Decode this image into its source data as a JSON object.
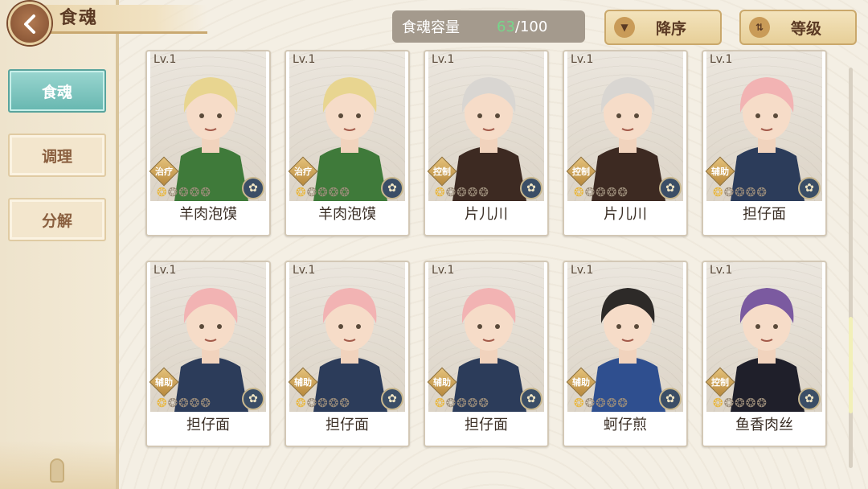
{
  "header": {
    "title": "食魂",
    "capacity_label": "食魂容量",
    "capacity_current": "63",
    "capacity_separator": "/",
    "capacity_max": "100",
    "sort_order_label": "降序",
    "sort_field_label": "等级"
  },
  "sidebar": {
    "tabs": [
      {
        "label": "食魂",
        "active": true
      },
      {
        "label": "调理",
        "active": false
      },
      {
        "label": "分解",
        "active": false
      }
    ]
  },
  "icons": {
    "back": "chevron-left-icon",
    "sort_order": "triangle-down-icon",
    "sort_field": "swap-vertical-icon",
    "element_badge": "flower-emblem-icon"
  },
  "colors": {
    "active_tab": "#67b7b0",
    "capacity_current": "#76d68a",
    "star_lit": "#e9b63b"
  },
  "cards": [
    {
      "level": "Lv.1",
      "role": "治疗",
      "name": "羊肉泡馍",
      "stars_lit": 1,
      "stars_total": 5,
      "hair": "#e8d590",
      "outfit": "#3f7a3a"
    },
    {
      "level": "Lv.1",
      "role": "治疗",
      "name": "羊肉泡馍",
      "stars_lit": 1,
      "stars_total": 5,
      "hair": "#e8d590",
      "outfit": "#3f7a3a"
    },
    {
      "level": "Lv.1",
      "role": "控制",
      "name": "片儿川",
      "stars_lit": 1,
      "stars_total": 5,
      "hair": "#d9d6d2",
      "outfit": "#3d2a22"
    },
    {
      "level": "Lv.1",
      "role": "控制",
      "name": "片儿川",
      "stars_lit": 1,
      "stars_total": 5,
      "hair": "#d9d6d2",
      "outfit": "#3d2a22"
    },
    {
      "level": "Lv.1",
      "role": "辅助",
      "name": "担仔面",
      "stars_lit": 1,
      "stars_total": 5,
      "hair": "#f2b3b3",
      "outfit": "#2c3c5a"
    },
    {
      "level": "Lv.1",
      "role": "辅助",
      "name": "担仔面",
      "stars_lit": 1,
      "stars_total": 5,
      "hair": "#f2b3b3",
      "outfit": "#2c3c5a"
    },
    {
      "level": "Lv.1",
      "role": "辅助",
      "name": "担仔面",
      "stars_lit": 1,
      "stars_total": 5,
      "hair": "#f2b3b3",
      "outfit": "#2c3c5a"
    },
    {
      "level": "Lv.1",
      "role": "辅助",
      "name": "担仔面",
      "stars_lit": 1,
      "stars_total": 5,
      "hair": "#f2b3b3",
      "outfit": "#2c3c5a"
    },
    {
      "level": "Lv.1",
      "role": "辅助",
      "name": "蚵仔煎",
      "stars_lit": 1,
      "stars_total": 5,
      "hair": "#2d2a28",
      "outfit": "#2f4f8f"
    },
    {
      "level": "Lv.1",
      "role": "控制",
      "name": "鱼香肉丝",
      "stars_lit": 1,
      "stars_total": 5,
      "hair": "#7b5aa0",
      "outfit": "#1f1f2a"
    }
  ]
}
